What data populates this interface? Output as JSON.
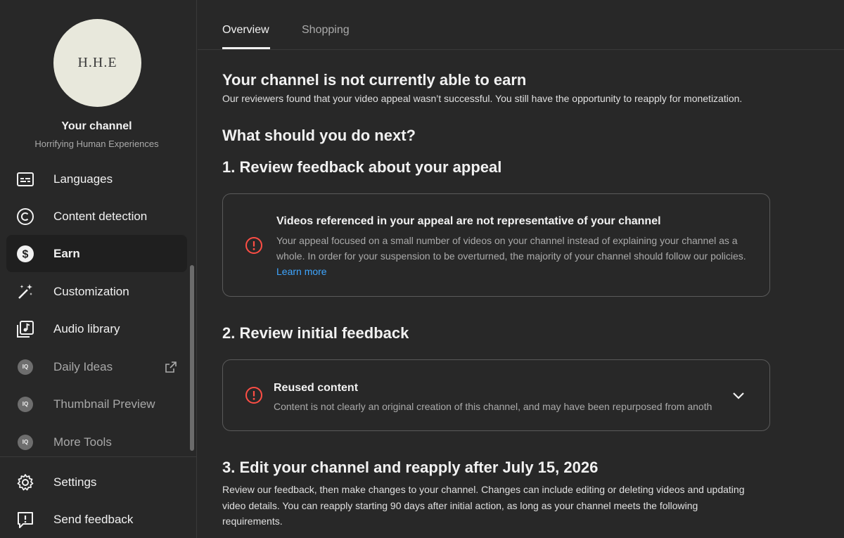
{
  "channel": {
    "avatar_text": "H.H.E",
    "title": "Your channel",
    "subtitle": "Horrifying Human Experiences"
  },
  "sidebar": {
    "items": [
      {
        "label": "Languages"
      },
      {
        "label": "Content detection"
      },
      {
        "label": "Earn",
        "active": true
      },
      {
        "label": "Customization"
      },
      {
        "label": "Audio library"
      },
      {
        "label": "Daily Ideas",
        "badge": "IQ"
      },
      {
        "label": "Thumbnail Preview",
        "badge": "IQ"
      },
      {
        "label": "More Tools",
        "badge": "IQ"
      }
    ],
    "bottom": [
      {
        "label": "Settings"
      },
      {
        "label": "Send feedback"
      }
    ]
  },
  "tabs": [
    {
      "label": "Overview",
      "active": true
    },
    {
      "label": "Shopping"
    }
  ],
  "status": {
    "heading": "Your channel is not currently able to earn",
    "text": "Our reviewers found that your video appeal wasn’t successful. You still have the opportunity to reapply for monetization."
  },
  "next": {
    "heading": "What should you do next?",
    "step1": {
      "heading": "1. Review feedback about your appeal",
      "card_title": "Videos referenced in your appeal are not representative of your channel",
      "card_text": "Your appeal focused on a small number of videos on your channel instead of explaining your channel as a whole. In order for your suspension to be overturned, the majority of your channel should follow our policies.",
      "link": "Learn more"
    },
    "step2": {
      "heading": "2. Review initial feedback",
      "card_title": "Reused content",
      "card_text": "Content is not clearly an original creation of this channel, and may have been repurposed from anoth"
    },
    "step3": {
      "heading": "3. Edit your channel and reapply after July 15, 2026",
      "text": "Review our feedback, then make changes to your channel. Changes can include editing or deleting videos and updating video details. You can reapply starting 90 days after initial action, as long as your channel meets the following requirements."
    }
  },
  "colors": {
    "background": "#282828",
    "warning": "#ff4e45",
    "link": "#3ea6ff"
  }
}
